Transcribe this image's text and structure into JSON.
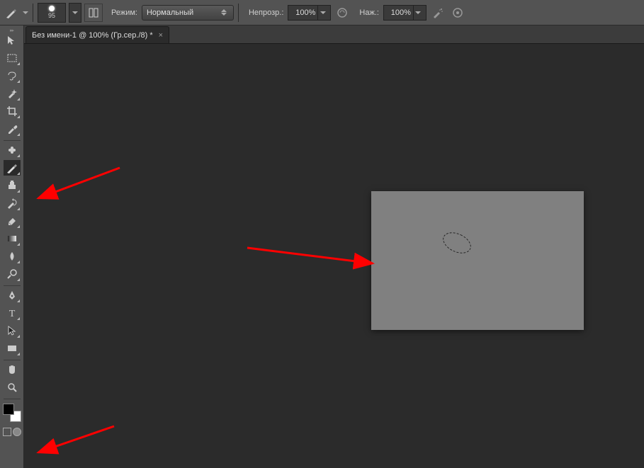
{
  "options_bar": {
    "brush_size": "95",
    "mode_label": "Режим:",
    "mode_value": "Нормальный",
    "opacity_label": "Непрозр.:",
    "opacity_value": "100%",
    "flow_label": "Наж.:",
    "flow_value": "100%"
  },
  "document_tab": {
    "title": "Без имени-1 @ 100% (Гр.сер./8) *",
    "close": "×"
  },
  "tools": [
    {
      "name": "move-tool",
      "corner": false
    },
    {
      "name": "rectangular-marquee-tool",
      "corner": true
    },
    {
      "name": "lasso-tool",
      "corner": true
    },
    {
      "name": "quick-selection-tool",
      "corner": true
    },
    {
      "name": "crop-tool",
      "corner": true
    },
    {
      "name": "eyedropper-tool",
      "corner": true
    },
    {
      "name": "healing-brush-tool",
      "corner": true
    },
    {
      "name": "brush-tool",
      "corner": true,
      "active": true
    },
    {
      "name": "clone-stamp-tool",
      "corner": true
    },
    {
      "name": "history-brush-tool",
      "corner": true
    },
    {
      "name": "eraser-tool",
      "corner": true
    },
    {
      "name": "gradient-tool",
      "corner": true
    },
    {
      "name": "blur-tool",
      "corner": true
    },
    {
      "name": "dodge-tool",
      "corner": true
    },
    {
      "name": "pen-tool",
      "corner": true
    },
    {
      "name": "type-tool",
      "corner": true
    },
    {
      "name": "path-selection-tool",
      "corner": true
    },
    {
      "name": "rectangle-tool",
      "corner": true
    },
    {
      "name": "hand-tool",
      "corner": false
    },
    {
      "name": "zoom-tool",
      "corner": false
    }
  ],
  "colors": {
    "foreground": "#000000",
    "background": "#ffffff"
  }
}
